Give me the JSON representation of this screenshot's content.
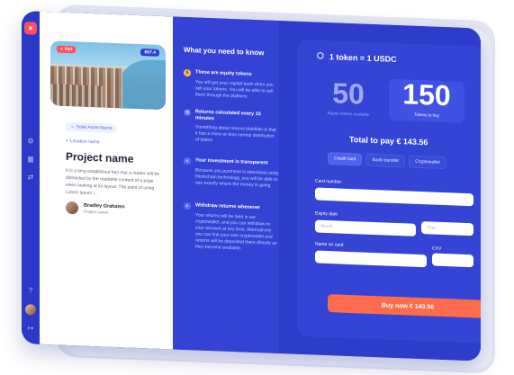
{
  "badges": {
    "hot": "Hot",
    "price": "657.4"
  },
  "project": {
    "asset": "Solar Asset Name",
    "location": "Location name",
    "title": "Project name",
    "description": "It is a long established fact that a reader will be distracted by the readable content of a page when looking at its layout. The point of using Lorem Ipsum i...",
    "owner_name": "Bradley Grahams",
    "owner_role": "Project owner"
  },
  "info": {
    "title": "What you need to know",
    "items": [
      {
        "heading": "These are equity tokens",
        "text": "You will get your capital back when you sell your tokens. You will be able to sell them through the platform."
      },
      {
        "heading": "Returns calculated every 15 minutes",
        "text": "Something about returns blahblah is that it has a more-or-less normal distribution of letters"
      },
      {
        "heading": "Your investment is transparent",
        "text": "Because you purchase is tokenised using blockchain technology, you will be able to see exactly where the money is going"
      },
      {
        "heading": "Withdraw returns whenever",
        "text": "Your returns will be held in our cryptowallet, and you can withdraw to your account at any time. Alternatively you can link your own cryptowallet and returns will be deposited there directly as they become available."
      }
    ]
  },
  "purchase": {
    "token_rate": "1 token = 1 USDC",
    "available_value": "50",
    "available_label": "Equity tokens available",
    "buy_value": "150",
    "buy_label": "Tokens to buy",
    "total_label": "Total to pay",
    "total_value": "€ 143.56",
    "tabs": [
      "Credit card",
      "Bank transfer",
      "Cryptowallet"
    ],
    "card_number_label": "Card number",
    "expiry_label": "Expiry date",
    "month_placeholder": "Month",
    "year_placeholder": "Year",
    "name_label": "Name on card",
    "cvv_label": "CVV",
    "buy_button": "Buy now € 143.56"
  },
  "colors": {
    "primary": "#2f3fd3",
    "accent": "#ff6b4d",
    "hot": "#ff4f5e"
  },
  "icons": {
    "logo": "logo-icon",
    "settings": "settings-icon",
    "grid": "grid-icon",
    "swap": "swap-icon",
    "help": "help-icon",
    "logout": "logout-icon"
  }
}
